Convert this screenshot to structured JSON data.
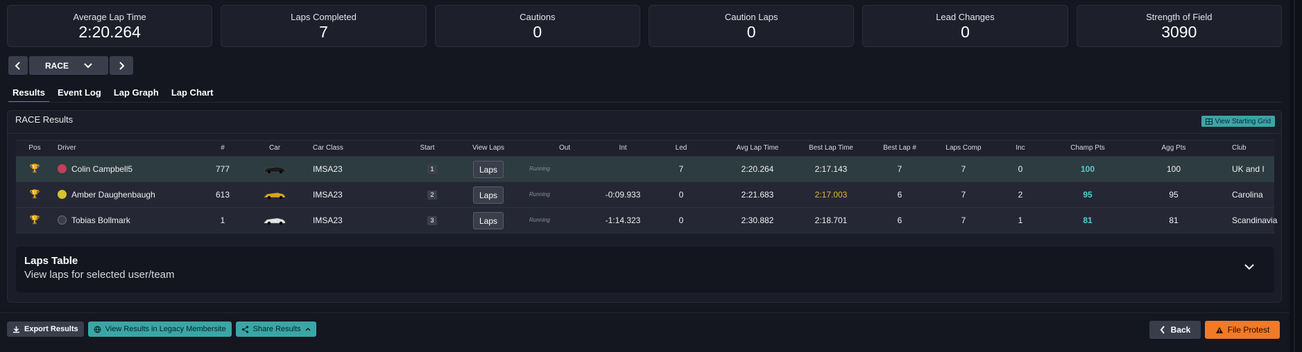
{
  "stats": [
    {
      "label": "Average Lap Time",
      "value": "2:20.264"
    },
    {
      "label": "Laps Completed",
      "value": "7"
    },
    {
      "label": "Cautions",
      "value": "0"
    },
    {
      "label": "Caution Laps",
      "value": "0"
    },
    {
      "label": "Lead Changes",
      "value": "0"
    },
    {
      "label": "Strength of Field",
      "value": "3090"
    }
  ],
  "session_nav": {
    "selected": "RACE"
  },
  "tabs": [
    "Results",
    "Event Log",
    "Lap Graph",
    "Lap Chart"
  ],
  "results": {
    "title": "RACE Results",
    "view_grid_label": "View Starting Grid",
    "columns": [
      "Pos",
      "Driver",
      "#",
      "Car",
      "Car Class",
      "Start",
      "View Laps",
      "Out",
      "Int",
      "Led",
      "Avg Lap Time",
      "Best Lap Time",
      "Best Lap #",
      "Laps Comp",
      "Inc",
      "Champ Pts",
      "Agg Pts",
      "Club"
    ],
    "rows": [
      {
        "trophy_color": "#e8c21c",
        "helmet_color": "#c0405a",
        "driver": "Colin Campbell5",
        "number": "777",
        "car_color": "#1a1a1a",
        "car_class": "IMSA23",
        "start": "1",
        "laps_label": "Laps",
        "out": "Running",
        "int": "",
        "led": "7",
        "avg": "2:20.264",
        "best": "2:17.143",
        "best_lap": "7",
        "laps_comp": "7",
        "inc": "0",
        "champ": "100",
        "agg": "100",
        "club": "UK and I"
      },
      {
        "trophy_color": "#c8ccd4",
        "helmet_color": "#d6c22a",
        "driver": "Amber Daughenbaugh",
        "number": "613",
        "car_color": "#d9a51c",
        "car_class": "IMSA23",
        "start": "2",
        "laps_label": "Laps",
        "out": "Running",
        "int": "-0:09.933",
        "led": "0",
        "avg": "2:21.683",
        "best": "2:17.003",
        "best_lap": "6",
        "laps_comp": "7",
        "inc": "2",
        "champ": "95",
        "agg": "95",
        "club": "Carolina"
      },
      {
        "trophy_color": "#d0822a",
        "helmet_color": "#3a3e4b",
        "driver": "Tobias Bollmark",
        "number": "1",
        "car_color": "#e4e4e4",
        "car_class": "IMSA23",
        "start": "3",
        "laps_label": "Laps",
        "out": "Running",
        "int": "-1:14.323",
        "led": "0",
        "avg": "2:30.882",
        "best": "2:18.701",
        "best_lap": "6",
        "laps_comp": "7",
        "inc": "1",
        "champ": "81",
        "agg": "81",
        "club": "Scandinavia"
      }
    ]
  },
  "laps_table": {
    "title": "Laps Table",
    "subtitle": "View laps for selected user/team"
  },
  "footer": {
    "export_label": "Export Results",
    "legacy_label": "View Results in Legacy Membersite",
    "share_label": "Share Results",
    "back_label": "Back",
    "protest_label": "File Protest"
  },
  "colors": {
    "accent_teal": "#3aa6a6",
    "protest_orange": "#f07a28",
    "best_lap_gold": "#e6b63a",
    "tab_underline": "#2f80ed"
  }
}
